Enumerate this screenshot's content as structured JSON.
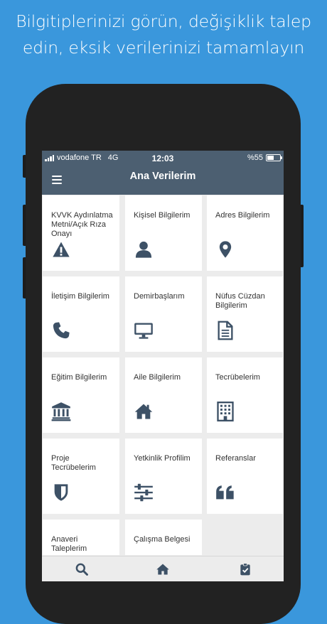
{
  "headline": {
    "line1": "Bilgitiplerinizi görün, değişiklik talep",
    "line2": "edin, eksik verilerinizi tamamlayın"
  },
  "status_bar": {
    "carrier": "vodafone TR",
    "network": "4G",
    "time": "12:03",
    "battery": "%55",
    "battery_level": 0.55
  },
  "app_bar": {
    "title": "Ana Verilerim",
    "menu_icon": "hamburger-menu-icon"
  },
  "tiles": [
    {
      "label": "KVVK Aydınlatma Metni/Açık Rıza Onayı",
      "icon": "warning-triangle-icon"
    },
    {
      "label": "Kişisel Bilgilerim",
      "icon": "user-icon"
    },
    {
      "label": "Adres Bilgilerim",
      "icon": "map-marker-icon"
    },
    {
      "label": "İletişim Bilgilerim",
      "icon": "phone-icon"
    },
    {
      "label": "Demirbaşlarım",
      "icon": "monitor-icon"
    },
    {
      "label": "Nüfus Cüzdan Bilgilerim",
      "icon": "document-icon"
    },
    {
      "label": "Eğitim Bilgilerim",
      "icon": "institution-icon"
    },
    {
      "label": "Aile Bilgilerim",
      "icon": "home-icon"
    },
    {
      "label": "Tecrübelerim",
      "icon": "building-icon"
    },
    {
      "label": "Proje Tecrübelerim",
      "icon": "shield-icon"
    },
    {
      "label": "Yetkinlik Profilim",
      "icon": "sliders-icon"
    },
    {
      "label": "Referanslar",
      "icon": "quote-icon"
    },
    {
      "label": "Anaveri Taleplerim",
      "icon": ""
    },
    {
      "label": "Çalışma Belgesi",
      "icon": ""
    }
  ],
  "bottom_nav": [
    {
      "icon": "search-icon"
    },
    {
      "icon": "home-icon"
    },
    {
      "icon": "clipboard-check-icon"
    }
  ],
  "colors": {
    "background": "#3a97dc",
    "app_bar": "#4c5f71",
    "icon": "#3d5166",
    "tile": "#ffffff",
    "grid_bg": "#ececec"
  }
}
